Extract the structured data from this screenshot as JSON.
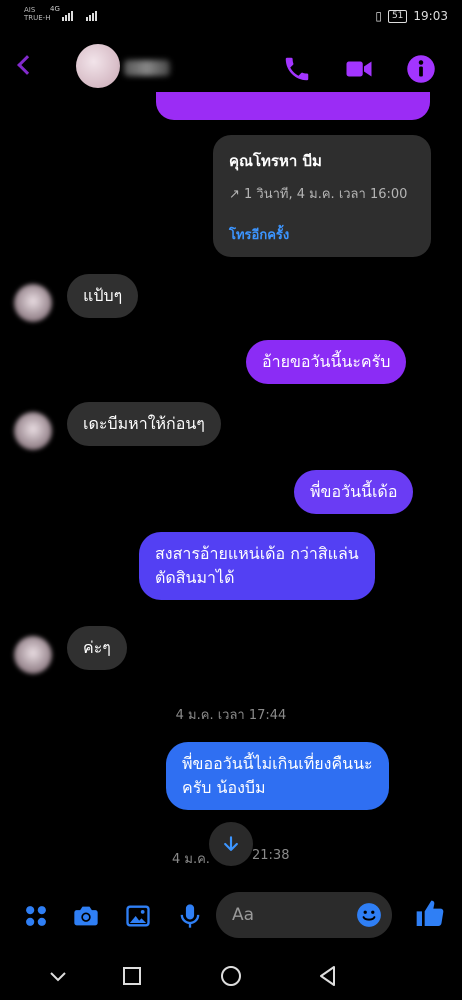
{
  "status": {
    "carrier1": "AIS",
    "carrier2": "TRUE-H",
    "network": "4G",
    "battery": "51",
    "time": "19:03"
  },
  "colors": {
    "accent": "#a335ff",
    "link": "#3c95ff",
    "incoming": "#303030",
    "out_purple": "#8b2cf5",
    "out_violet": "#6a3cf4",
    "out_blue": "#2f6ff2"
  },
  "header": {
    "icons": [
      "back-icon",
      "phone-icon",
      "video-icon",
      "info-icon"
    ]
  },
  "call_card": {
    "title": "คุณโทรหา บีม",
    "subtitle": "↗ 1 วินาที, 4 ม.ค. เวลา 16:00",
    "action": "โทรอีกครั้ง"
  },
  "messages": [
    {
      "dir": "in",
      "text": "แป้บๆ"
    },
    {
      "dir": "out",
      "text": "อ้ายขอวันนี้นะครับ"
    },
    {
      "dir": "in",
      "text": "เดะบีมหาให้ก่อนๆ"
    },
    {
      "dir": "out",
      "text": "พี่ขอวันนี้เด้อ"
    },
    {
      "dir": "out",
      "line1": "สงสารอ้ายแหน่เด้อ กว่าสิแล่น",
      "line2": "ตัดสินมาได้"
    },
    {
      "dir": "in",
      "text": "ค่ะๆ"
    },
    {
      "dir": "out",
      "line1": "พี่ขออวันนี้ไม่เกินเที่ยงคืนนะ",
      "line2": "ครับ น้องบีม"
    }
  ],
  "timestamps": {
    "t1": "4 ม.ค. เวลา 17:44",
    "t2_left": "4 ม.ค.",
    "t2_right": "21:38"
  },
  "composer": {
    "placeholder": "Aa",
    "icons": [
      "apps-icon",
      "camera-icon",
      "gallery-icon",
      "mic-icon",
      "emoji-icon",
      "like-icon"
    ]
  }
}
